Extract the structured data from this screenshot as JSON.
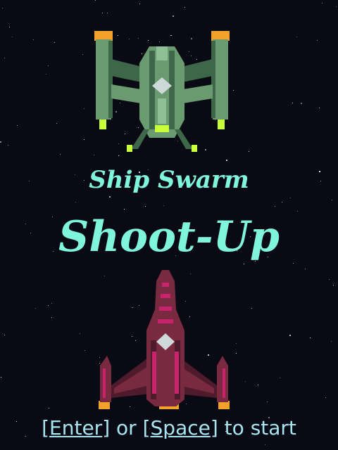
{
  "game": {
    "subtitle": "Ship Swarm",
    "title": "Shoot-Up",
    "prompt": {
      "key_enter": "Enter",
      "middle": " or ",
      "key_space": "Space",
      "suffix": " to start"
    }
  },
  "sprites": {
    "enemy_ship": "green-battleship-icon",
    "player_ship": "magenta-fighter-icon"
  },
  "colors": {
    "background": "#0a0a14",
    "title": "#7ff5dc",
    "prompt": "#a8e4f0",
    "star": "#e8e8f0",
    "enemy_body": "#6a9a70",
    "enemy_dark": "#3e6648",
    "enemy_light": "#8fbf94",
    "enemy_glow": "#c8ff3a",
    "enemy_thruster": "#f2a22a",
    "player_body": "#7a2a40",
    "player_dark": "#4e1a2c",
    "player_accent": "#c8246e",
    "player_thruster": "#f2a22a",
    "cockpit": "#cfd8d8"
  }
}
